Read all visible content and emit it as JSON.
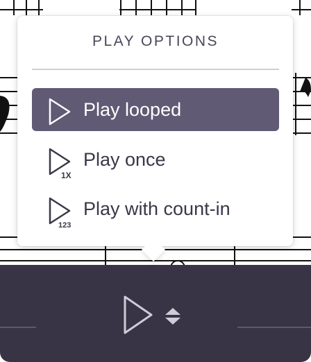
{
  "popover": {
    "title": "PLAY OPTIONS",
    "items": [
      {
        "label": "Play looped",
        "icon": "play-looped-icon",
        "selected": true
      },
      {
        "label": "Play once",
        "icon": "play-once-icon",
        "badge": "1X",
        "selected": false
      },
      {
        "label": "Play with count-in",
        "icon": "play-count-in-icon",
        "badge": "123",
        "selected": false
      }
    ]
  },
  "toolbar": {
    "play_icon": "play-icon",
    "options_icon": "up-down-chevron-icon"
  },
  "colors": {
    "selected_item_bg": "#615a74",
    "toolbar_bg": "#383445",
    "title_text": "#4a4658",
    "item_text": "#3b3748"
  }
}
